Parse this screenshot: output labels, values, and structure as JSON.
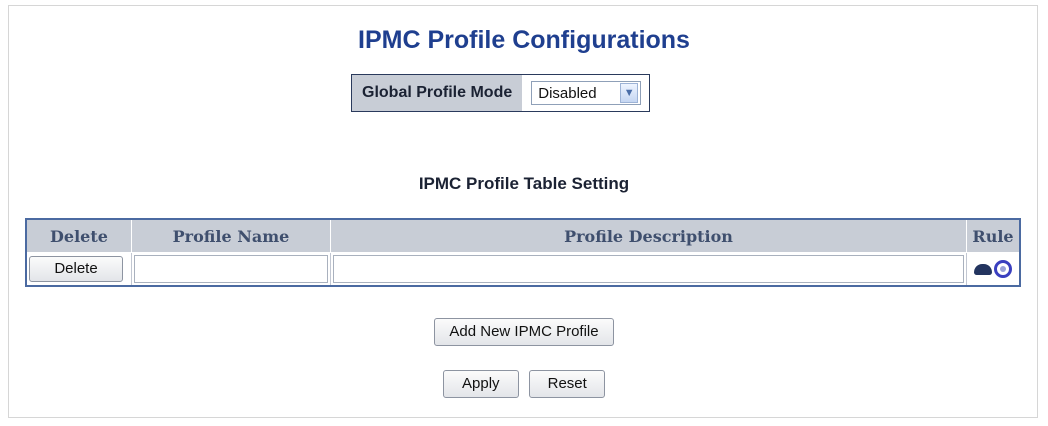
{
  "page": {
    "title": "IPMC Profile Configurations",
    "table_title": "IPMC Profile Table Setting"
  },
  "global_mode": {
    "label": "Global Profile Mode",
    "selected": "Disabled"
  },
  "table": {
    "headers": [
      "Delete",
      "Profile Name",
      "Profile Description",
      "Rule"
    ],
    "rows": [
      {
        "delete_label": "Delete",
        "profile_name": "",
        "profile_description": ""
      }
    ]
  },
  "icons": {
    "rule_edit": "edit-rule-icon",
    "rule_view": "view-rule-icon"
  },
  "buttons": {
    "add": "Add New IPMC Profile",
    "apply": "Apply",
    "reset": "Reset"
  }
}
